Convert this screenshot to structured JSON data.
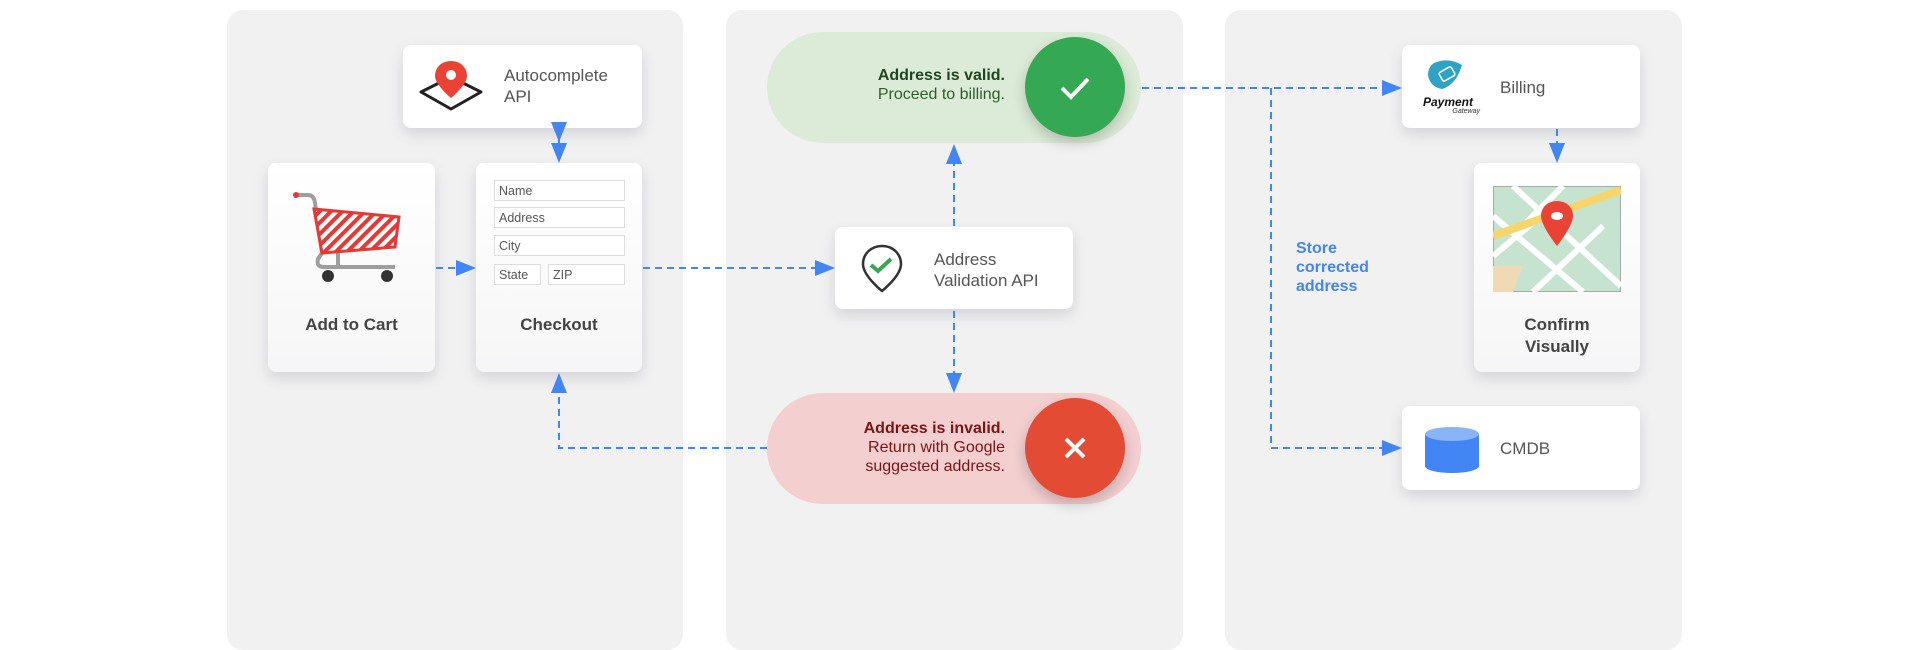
{
  "left_panel": {
    "autocomplete": {
      "label_line1": "Autocomplete",
      "label_line2": "API",
      "icon": "map-pin-diamond-icon"
    },
    "add_to_cart": {
      "title": "Add to Cart",
      "icon": "shopping-cart-icon"
    },
    "checkout": {
      "title": "Checkout",
      "fields": {
        "name": "Name",
        "address": "Address",
        "city": "City",
        "state": "State",
        "zip": "ZIP"
      }
    }
  },
  "middle_panel": {
    "valid": {
      "bold": "Address is valid.",
      "line2": "Proceed to billing.",
      "icon": "check-icon"
    },
    "validation_api": {
      "label_line1": "Address",
      "label_line2": "Validation API",
      "icon": "pin-check-icon"
    },
    "invalid": {
      "bold": "Address is invalid.",
      "line2": "Return with Google",
      "line3": "suggested address.",
      "icon": "x-icon"
    }
  },
  "right_panel": {
    "billing": {
      "label": "Billing",
      "logo_text": "Payment",
      "logo_subtext": "Gateway"
    },
    "confirm": {
      "title_line1": "Confirm",
      "title_line2": "Visually",
      "icon": "map-icon"
    },
    "store_label": {
      "line1": "Store",
      "line2": "corrected",
      "line3": "address"
    },
    "cmdb": {
      "label": "CMDB",
      "icon": "database-icon"
    }
  },
  "colors": {
    "arrow": "#4285f4",
    "valid": "#34a853",
    "invalid": "#e34b34",
    "valid_bg": "#dcebd7",
    "invalid_bg": "#f3cfd0"
  }
}
